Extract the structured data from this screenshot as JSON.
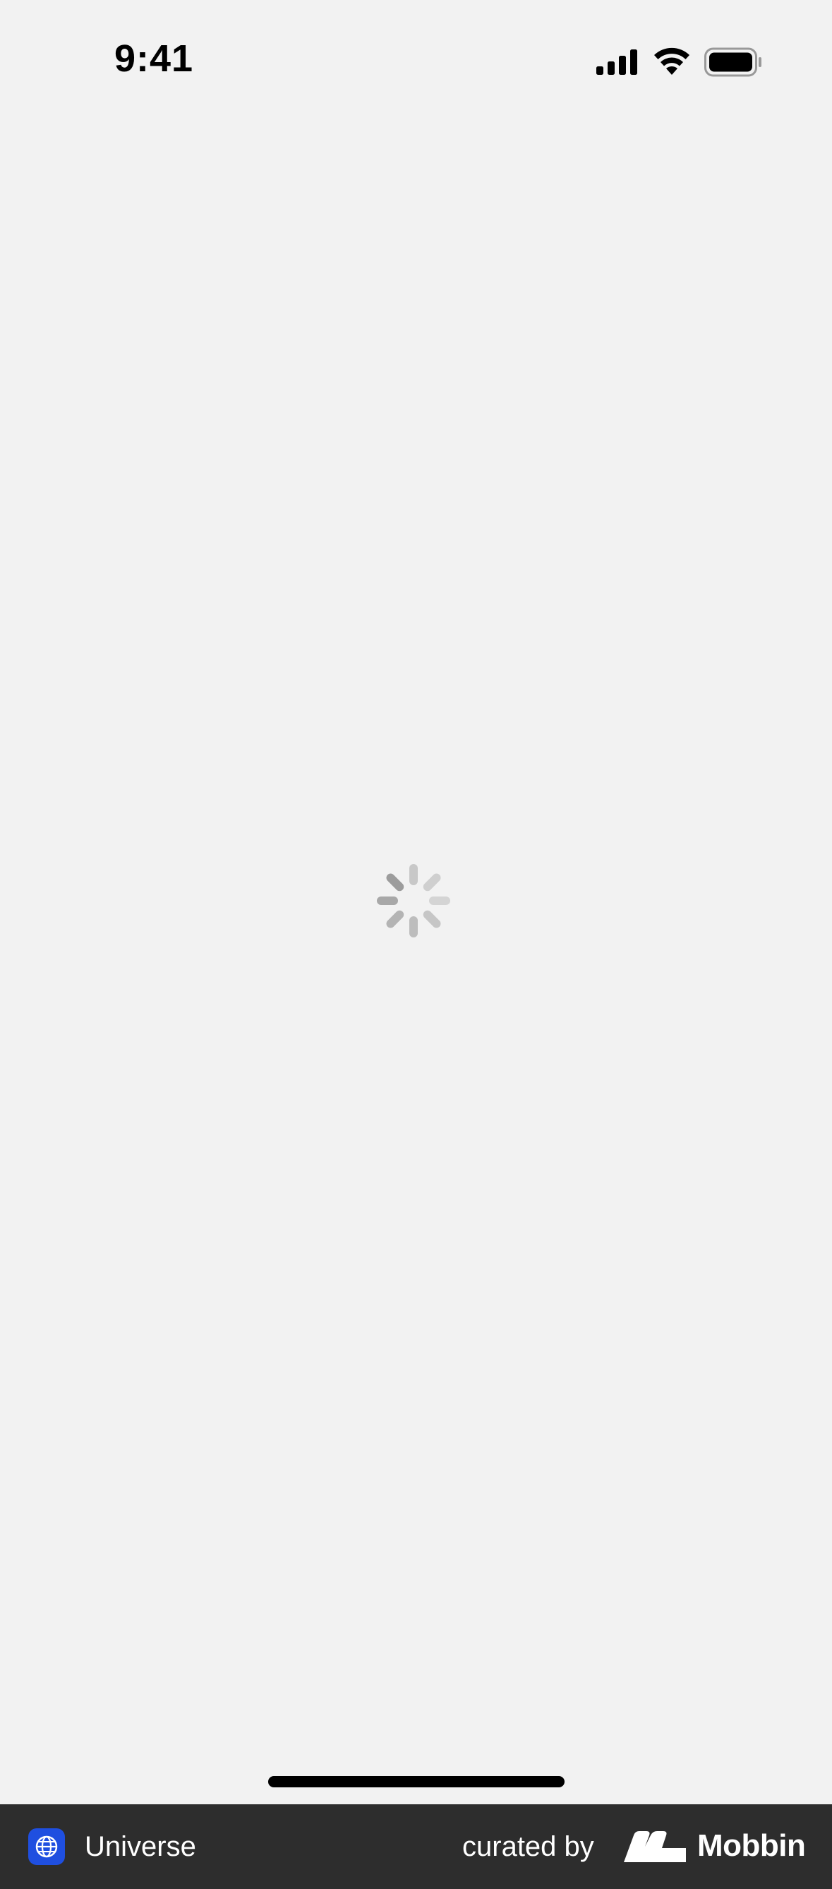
{
  "status_bar": {
    "time": "9:41",
    "icons": [
      "signal-icon",
      "wifi-icon",
      "battery-icon"
    ]
  },
  "main": {
    "state": "loading",
    "spinner_icon": "activity-indicator-icon"
  },
  "footer": {
    "app_name": "Universe",
    "app_icon": "globe-icon",
    "app_icon_color": "#1f4fe0",
    "curated_label": "curated by",
    "brand_name": "Mobbin",
    "brand_icon": "mobbin-logo-icon",
    "background": "#2d2d2d"
  }
}
